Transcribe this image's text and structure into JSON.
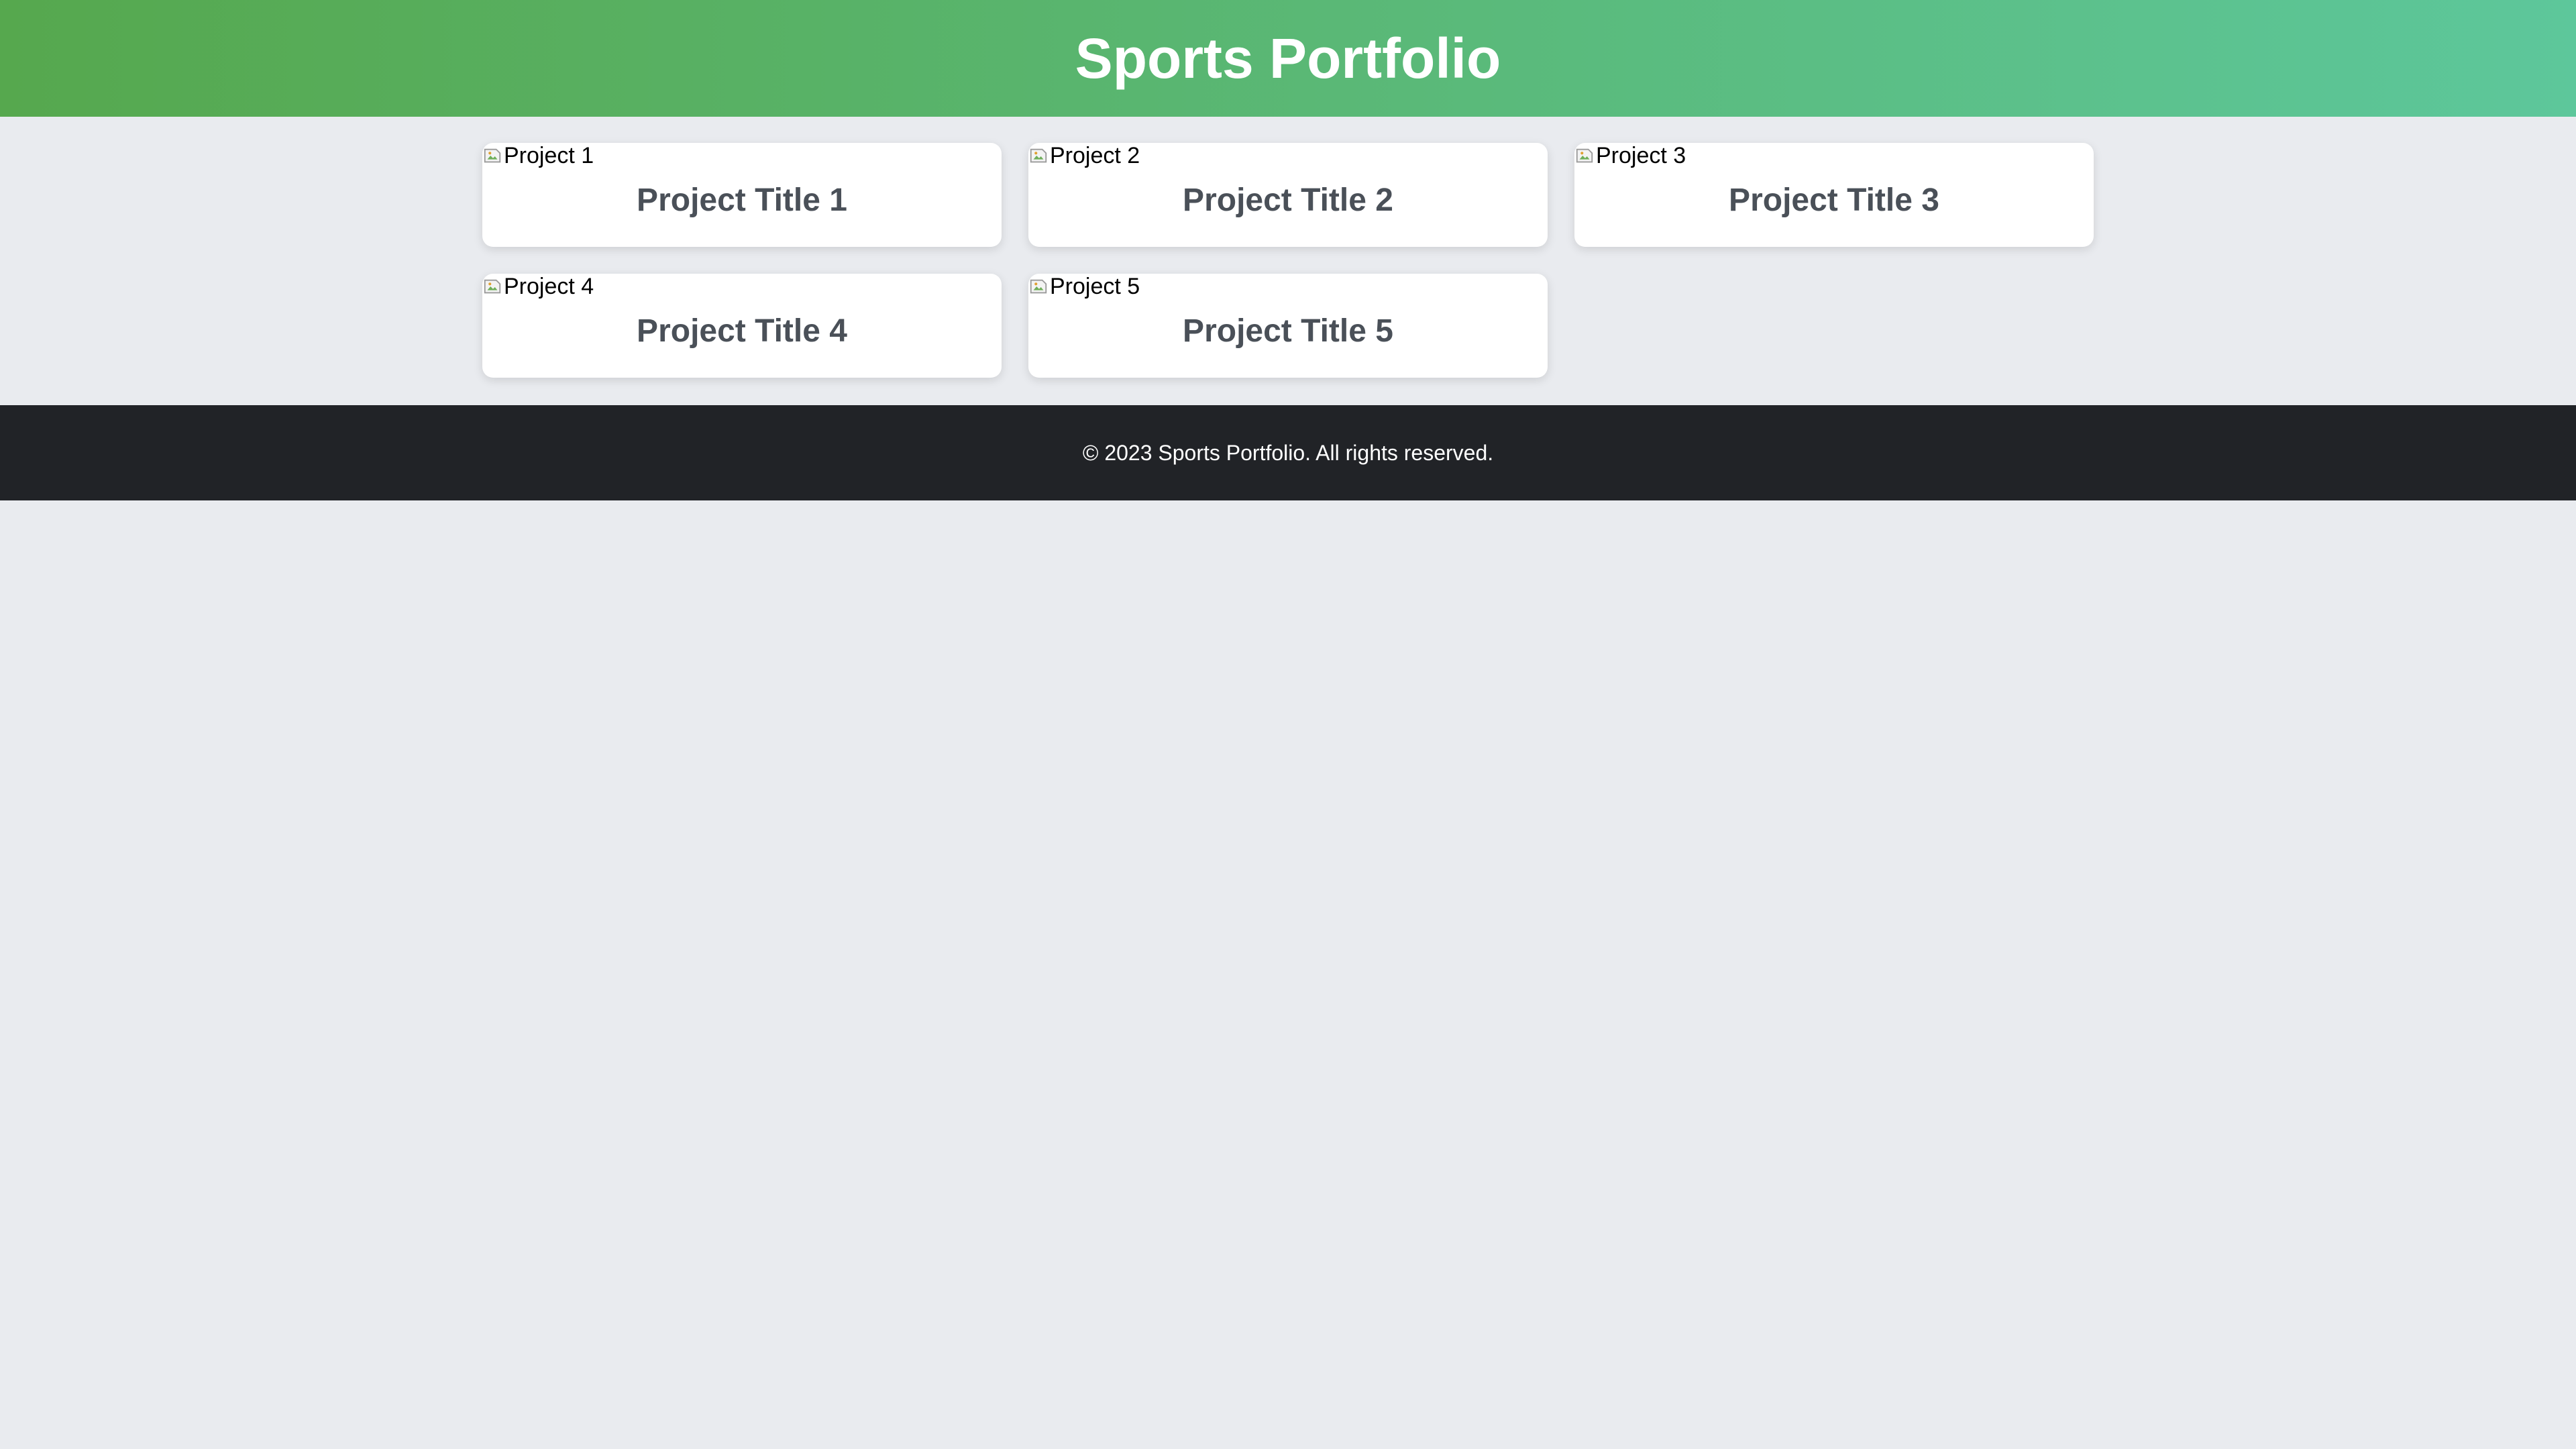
{
  "header": {
    "title": "Sports Portfolio"
  },
  "projects": [
    {
      "image_alt": "Project 1",
      "title": "Project Title 1"
    },
    {
      "image_alt": "Project 2",
      "title": "Project Title 2"
    },
    {
      "image_alt": "Project 3",
      "title": "Project Title 3"
    },
    {
      "image_alt": "Project 4",
      "title": "Project Title 4"
    },
    {
      "image_alt": "Project 5",
      "title": "Project Title 5"
    }
  ],
  "footer": {
    "text": "© 2023 Sports Portfolio. All rights reserved."
  },
  "colors": {
    "header_gradient_start": "#56a84e",
    "header_gradient_end": "#5dc79b",
    "page_background": "#e9ebef",
    "card_title": "#4a5058",
    "footer_background": "#212327"
  },
  "icons": {
    "broken_image": "broken-image-icon"
  }
}
